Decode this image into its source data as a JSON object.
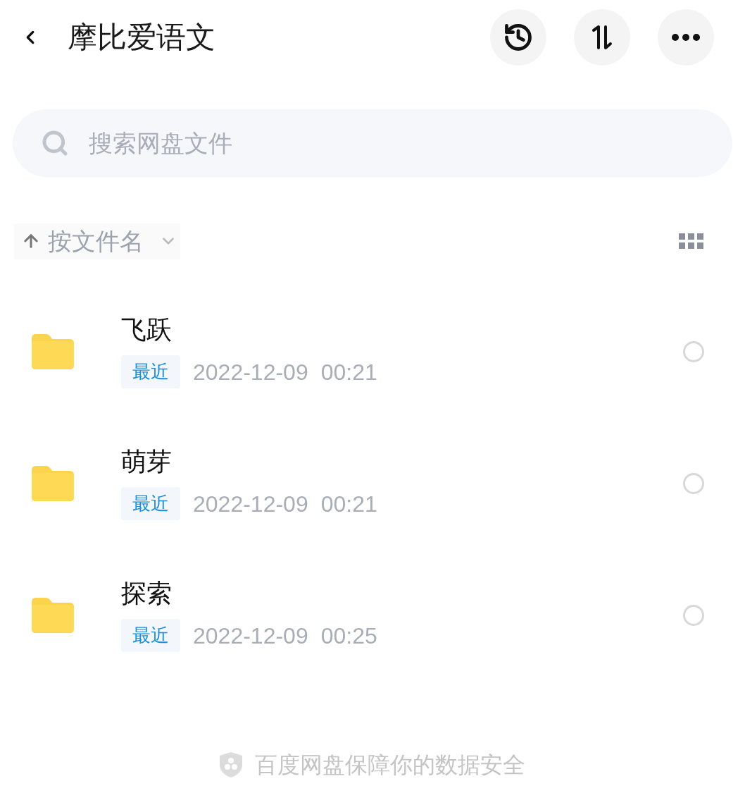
{
  "header": {
    "title": "摩比爱语文"
  },
  "search": {
    "placeholder": "搜索网盘文件"
  },
  "sort": {
    "label": "按文件名"
  },
  "files": [
    {
      "name": "飞跃",
      "tag": "最近",
      "date": "2022-12-09",
      "time": "00:21",
      "selected": false
    },
    {
      "name": "萌芽",
      "tag": "最近",
      "date": "2022-12-09",
      "time": "00:21",
      "selected": false
    },
    {
      "name": "探索",
      "tag": "最近",
      "date": "2022-12-09",
      "time": "00:25",
      "selected": false
    }
  ],
  "footer": {
    "text": "百度网盘保障你的数据安全"
  }
}
